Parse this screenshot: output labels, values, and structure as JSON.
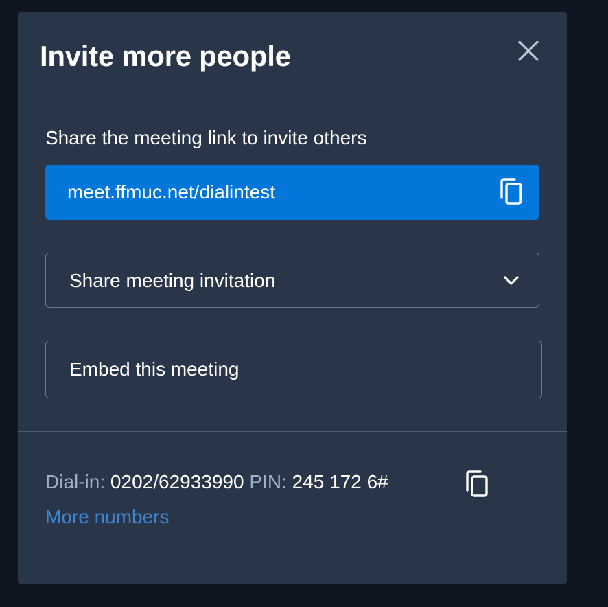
{
  "dialog": {
    "title": "Invite more people",
    "close_icon": "close-icon",
    "share_label": "Share the meeting link to invite others",
    "link": {
      "url": "meet.ffmuc.net/dialintest",
      "copy_icon": "copy-icon"
    },
    "share_invitation": {
      "label": "Share meeting invitation",
      "icon": "chevron-down-icon"
    },
    "embed": {
      "label": "Embed this meeting"
    },
    "dial_in": {
      "label": "Dial-in:",
      "number": "0202/62933990",
      "pin_label": "PIN:",
      "pin": "245 172 6#",
      "copy_icon": "copy-icon"
    },
    "more_numbers": "More numbers"
  },
  "colors": {
    "dialog_bg": "#293548",
    "link_bg": "#0376da",
    "link_text_accent": "#3e85cf",
    "muted_text": "#9fb1c8"
  }
}
